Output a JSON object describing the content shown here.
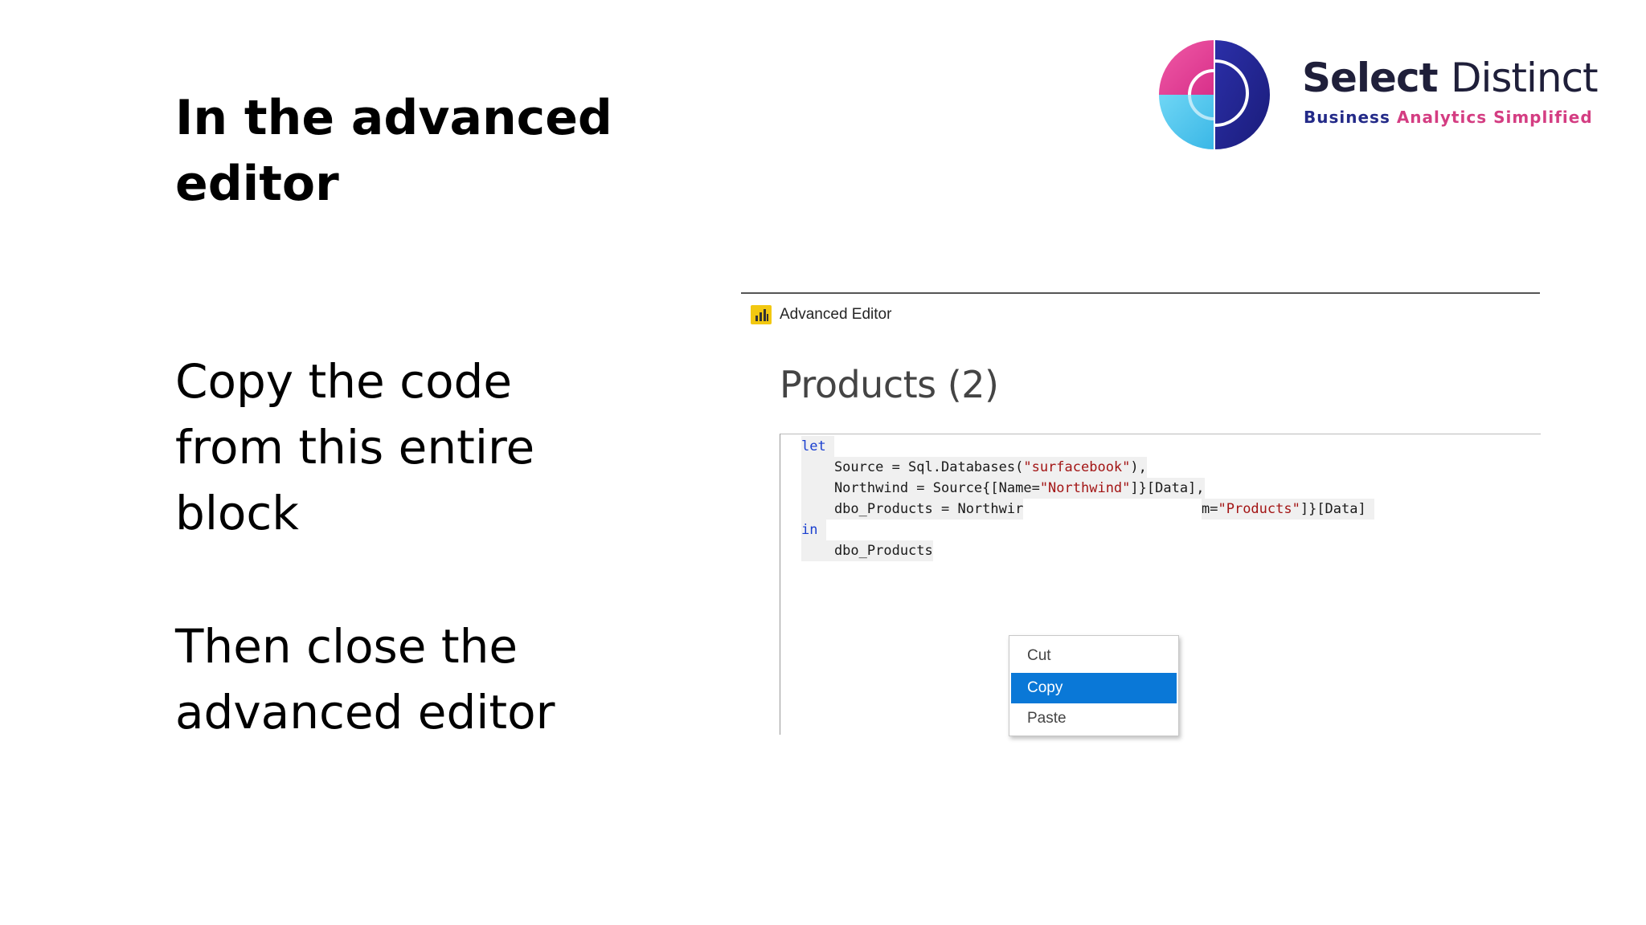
{
  "slide": {
    "title": "In the advanced editor",
    "copy_instruction": "Copy the code from this entire block",
    "close_instruction": "Then close the advanced editor"
  },
  "logo": {
    "name_part1": "Select",
    "name_part2": "Distinct",
    "tagline_part1": "Business",
    "tagline_part2": "Analytics Simplified",
    "colors": {
      "navy": "#232a88",
      "pink": "#e8348a",
      "cyan": "#48c6ee"
    }
  },
  "editor": {
    "window_title": "Advanced Editor",
    "query_name": "Products (2)",
    "code": {
      "let_kw": "let",
      "line1_prefix": "    Source = Sql.Databases(",
      "line1_str": "\"surfacebook\"",
      "line1_suffix": "),",
      "line2_prefix": "    Northwind = Source{[Name=",
      "line2_str": "\"Northwind\"",
      "line2_suffix": "]}[Data],",
      "line3_prefix": "    dbo_Products = Northwir",
      "line3_visible_end_prefix": "m=",
      "line3_str": "\"Products\"",
      "line3_suffix": "]}[Data]",
      "in_kw": "in",
      "line5": "    dbo_Products"
    },
    "context_menu": {
      "items": [
        "Cut",
        "Copy",
        "Paste"
      ],
      "selected": "Copy",
      "highlight_color": "#0a78d7"
    }
  }
}
